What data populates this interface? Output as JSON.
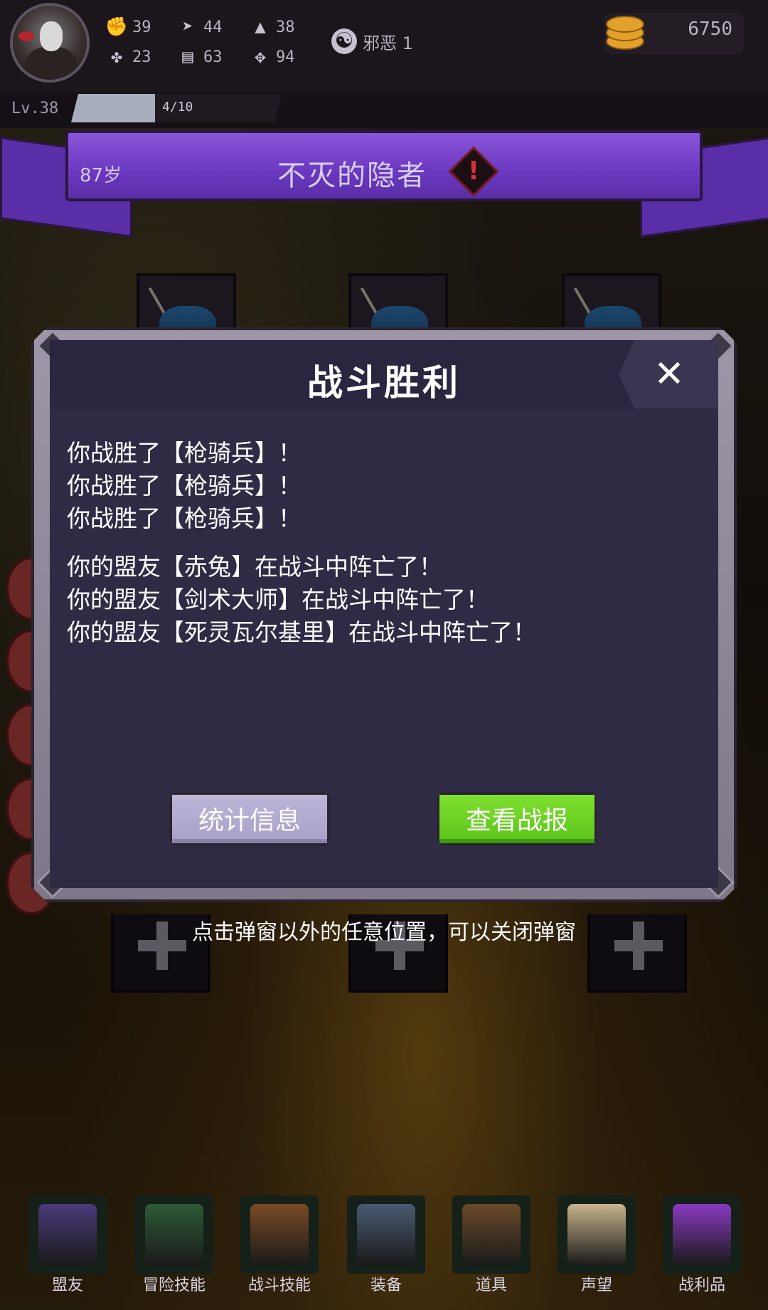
{
  "player": {
    "stats": [
      {
        "icon": "fist-icon",
        "value": "39"
      },
      {
        "icon": "clover-icon",
        "value": "23"
      },
      {
        "icon": "boot-icon",
        "value": "44"
      },
      {
        "icon": "book-icon",
        "value": "63"
      },
      {
        "icon": "wizard-hat-icon",
        "value": "38"
      },
      {
        "icon": "wings-icon",
        "value": "94"
      }
    ],
    "alignment": "邪恶 1",
    "gold": "6750",
    "level_label": "Lv.38",
    "xp_text": "4/10",
    "xp_progress": 0.4,
    "age": "87岁",
    "class_title": "不灭的隐者"
  },
  "modal": {
    "title": "战斗胜利",
    "close_label": "✕",
    "victory_lines": [
      "你战胜了【枪骑兵】！",
      "你战胜了【枪骑兵】！",
      "你战胜了【枪骑兵】！"
    ],
    "loss_lines": [
      "你的盟友【赤兔】在战斗中阵亡了！",
      "你的盟友【剑术大师】在战斗中阵亡了！",
      "你的盟友【死灵瓦尔基里】在战斗中阵亡了！"
    ],
    "btn_stats": "统计信息",
    "btn_report": "查看战报"
  },
  "hint": "点击弹窗以外的任意位置，可以关闭弹窗",
  "nav": [
    {
      "label": "盟友",
      "icon": "handshake-icon",
      "color": "#4a3a7a"
    },
    {
      "label": "冒险技能",
      "icon": "green-book-icon",
      "color": "#2e5a36"
    },
    {
      "label": "战斗技能",
      "icon": "backpack-icon",
      "color": "#7a4a24"
    },
    {
      "label": "装备",
      "icon": "crossed-swords-shield-icon",
      "color": "#4a5a72"
    },
    {
      "label": "道具",
      "icon": "bag-icon",
      "color": "#6a4a2a"
    },
    {
      "label": "声望",
      "icon": "scroll-icon",
      "color": "#c8b48a"
    },
    {
      "label": "战利品",
      "icon": "treasure-chest-icon",
      "color": "#8a3ac0"
    }
  ],
  "colors": {
    "banner": "#6a38c0",
    "stats_button": "#bdb6d8",
    "report_button": "#6ad024",
    "gold": "#e2a12a"
  }
}
